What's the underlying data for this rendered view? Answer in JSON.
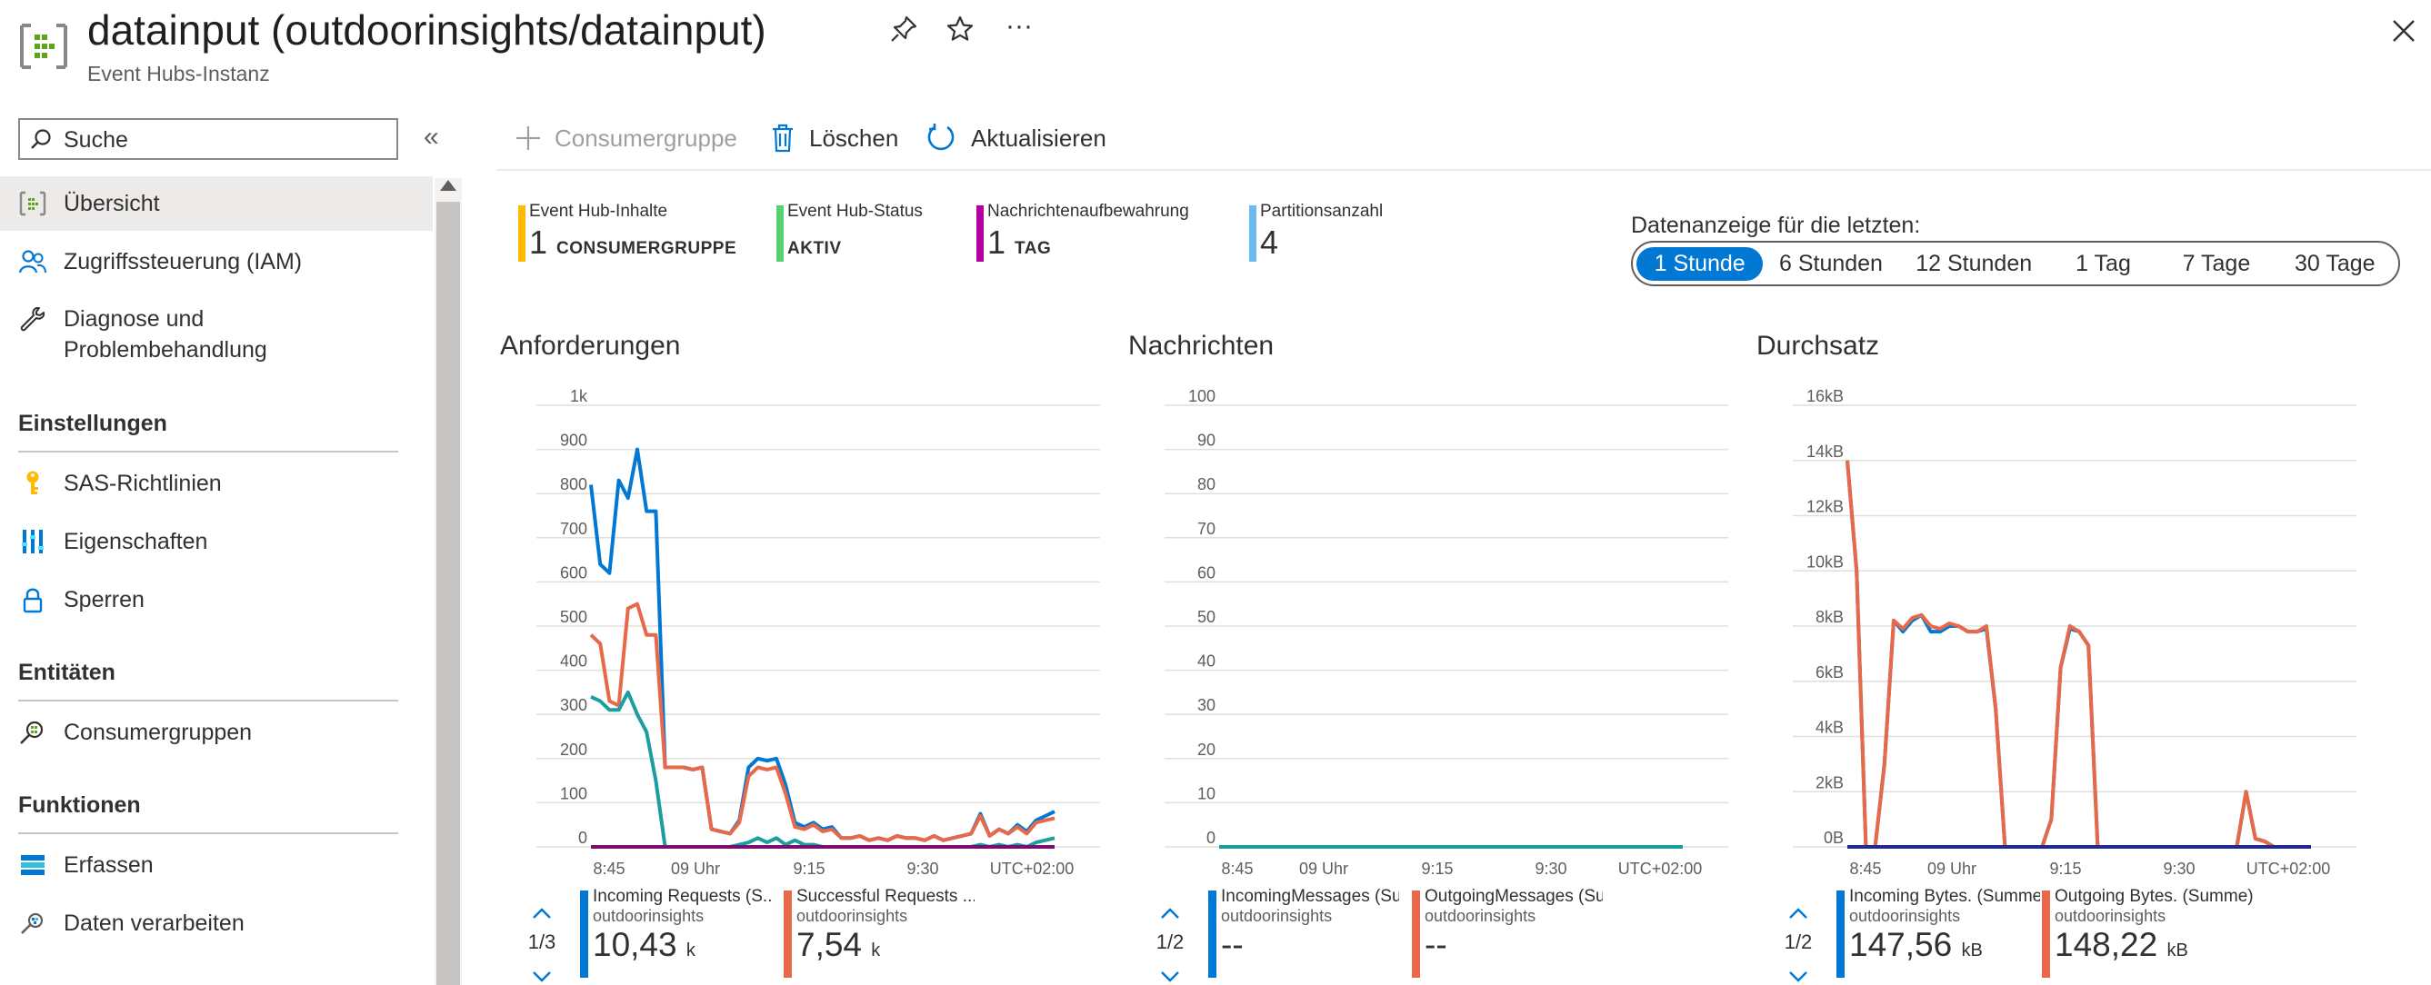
{
  "header": {
    "title": "datainput (outdoorinsights/datainput)",
    "subtitle": "Event Hubs-Instanz",
    "more_label": "···"
  },
  "sidebar": {
    "search_placeholder": "Suche",
    "collapse_label": "«",
    "items": [
      {
        "label": "Übersicht",
        "icon": "event-hub-icon",
        "active": true
      },
      {
        "label": "Zugriffssteuerung (IAM)",
        "icon": "people-icon"
      },
      {
        "label": "Diagnose und\nProblembehandlung",
        "icon": "wrench-icon"
      }
    ],
    "sections": [
      {
        "title": "Einstellungen",
        "items": [
          {
            "label": "SAS-Richtlinien",
            "icon": "key-icon"
          },
          {
            "label": "Eigenschaften",
            "icon": "properties-icon"
          },
          {
            "label": "Sperren",
            "icon": "lock-icon"
          }
        ]
      },
      {
        "title": "Entitäten",
        "items": [
          {
            "label": "Consumergruppen",
            "icon": "consumer-group-icon"
          }
        ]
      },
      {
        "title": "Funktionen",
        "items": [
          {
            "label": "Erfassen",
            "icon": "capture-icon"
          },
          {
            "label": "Daten verarbeiten",
            "icon": "process-data-icon"
          }
        ]
      }
    ]
  },
  "toolbar": {
    "consumer_group": "Consumergruppe",
    "delete": "Löschen",
    "refresh": "Aktualisieren"
  },
  "essentials": [
    {
      "label": "Event Hub-Inhalte",
      "value": "1",
      "unit": "CONSUMERGRUPPE",
      "color": "#ffb900"
    },
    {
      "label": "Event Hub-Status",
      "value": "",
      "unit": "AKTIV",
      "color": "#57d16e"
    },
    {
      "label": "Nachrichtenaufbewahrung",
      "value": "1",
      "unit": "TAG",
      "color": "#b4009e"
    },
    {
      "label": "Partitionsanzahl",
      "value": "4",
      "unit": "",
      "color": "#6ab9f0"
    }
  ],
  "time_range": {
    "label": "Datenanzeige für die letzten:",
    "options": [
      "1 Stunde",
      "6 Stunden",
      "12 Stunden",
      "1 Tag",
      "7 Tage",
      "30 Tage"
    ],
    "selected": "1 Stunde"
  },
  "charts": {
    "requests": {
      "title": "Anforderungen",
      "y_ticks": [
        "1k",
        "900",
        "800",
        "700",
        "600",
        "500",
        "400",
        "300",
        "200",
        "100",
        "0"
      ],
      "x_ticks": [
        "8:45",
        "09 Uhr",
        "9:15",
        "9:30",
        "UTC+02:00"
      ]
    },
    "messages": {
      "title": "Nachrichten",
      "y_ticks": [
        "100",
        "90",
        "80",
        "70",
        "60",
        "50",
        "40",
        "30",
        "20",
        "10",
        "0"
      ],
      "x_ticks": [
        "8:45",
        "09 Uhr",
        "9:15",
        "9:30",
        "UTC+02:00"
      ]
    },
    "throughput": {
      "title": "Durchsatz",
      "y_ticks": [
        "16kB",
        "14kB",
        "12kB",
        "10kB",
        "8kB",
        "6kB",
        "4kB",
        "2kB",
        "0B"
      ],
      "x_ticks": [
        "8:45",
        "09 Uhr",
        "9:15",
        "9:30",
        "UTC+02:00"
      ]
    }
  },
  "legends": {
    "requests": {
      "page": "1/3",
      "items": [
        {
          "name": "Incoming Requests (S...",
          "sub": "outdoorinsights",
          "value": "10,43",
          "unit": "k",
          "color": "#0078d4"
        },
        {
          "name": "Successful Requests ...",
          "sub": "outdoorinsights",
          "value": "7,54",
          "unit": "k",
          "color": "#e8694a"
        }
      ]
    },
    "messages": {
      "page": "1/2",
      "items": [
        {
          "name": "IncomingMessages (Su...",
          "sub": "outdoorinsights",
          "value": "--",
          "unit": "",
          "color": "#0078d4"
        },
        {
          "name": "OutgoingMessages (Su...",
          "sub": "outdoorinsights",
          "value": "--",
          "unit": "",
          "color": "#e8694a"
        }
      ]
    },
    "throughput": {
      "page": "1/2",
      "items": [
        {
          "name": "Incoming Bytes. (Summe)",
          "sub": "outdoorinsights",
          "value": "147,56",
          "unit": "kB",
          "color": "#0078d4"
        },
        {
          "name": "Outgoing Bytes. (Summe)",
          "sub": "outdoorinsights",
          "value": "148,22",
          "unit": "kB",
          "color": "#e8694a"
        }
      ]
    }
  },
  "chart_data": [
    {
      "type": "line",
      "title": "Anforderungen",
      "ylim": [
        0,
        1000
      ],
      "x": [
        0,
        1,
        2,
        3,
        4,
        5,
        6,
        7,
        8,
        9,
        10,
        11,
        12,
        13,
        14,
        15,
        16,
        17,
        18,
        19,
        20,
        21,
        22,
        23,
        24,
        25,
        26,
        27,
        28,
        29,
        30,
        31,
        32,
        33,
        34,
        35,
        36,
        37,
        38,
        39,
        40,
        41,
        42,
        43,
        44,
        45,
        46,
        47,
        48,
        49,
        50
      ],
      "series": [
        {
          "name": "Incoming Requests (S...",
          "color": "#0078d4",
          "values": [
            820,
            640,
            620,
            830,
            790,
            900,
            760,
            760,
            180,
            180,
            180,
            175,
            180,
            40,
            35,
            30,
            60,
            180,
            200,
            195,
            200,
            140,
            55,
            45,
            55,
            40,
            45,
            20,
            20,
            25,
            15,
            20,
            15,
            25,
            20,
            20,
            15,
            25,
            15,
            20,
            25,
            30,
            75,
            25,
            40,
            30,
            50,
            35,
            60,
            70,
            80
          ]
        },
        {
          "name": "Successful Requests ...",
          "color": "#e8694a",
          "values": [
            480,
            460,
            330,
            320,
            540,
            550,
            480,
            480,
            180,
            180,
            180,
            175,
            180,
            40,
            35,
            30,
            55,
            160,
            180,
            175,
            180,
            120,
            45,
            40,
            50,
            35,
            40,
            20,
            20,
            25,
            15,
            20,
            15,
            25,
            20,
            20,
            15,
            25,
            15,
            20,
            25,
            30,
            70,
            25,
            40,
            30,
            45,
            30,
            55,
            60,
            65
          ]
        },
        {
          "name": "",
          "color": "#1a9ea0",
          "values": [
            340,
            330,
            310,
            310,
            350,
            300,
            260,
            150,
            0,
            0,
            0,
            0,
            0,
            0,
            0,
            0,
            5,
            10,
            20,
            10,
            20,
            5,
            15,
            5,
            5,
            0,
            0,
            0,
            0,
            0,
            0,
            0,
            0,
            0,
            0,
            0,
            0,
            0,
            0,
            0,
            0,
            0,
            5,
            0,
            5,
            0,
            5,
            0,
            10,
            15,
            20
          ]
        },
        {
          "name": "",
          "color": "#7a0e6e",
          "values": [
            0,
            0,
            0,
            0,
            0,
            0,
            0,
            0,
            0,
            0,
            0,
            0,
            0,
            0,
            0,
            0,
            0,
            0,
            0,
            0,
            0,
            0,
            0,
            0,
            0,
            0,
            0,
            0,
            0,
            0,
            0,
            0,
            0,
            0,
            0,
            0,
            0,
            0,
            0,
            0,
            0,
            0,
            0,
            0,
            0,
            0,
            0,
            0,
            0,
            0,
            0
          ]
        }
      ]
    },
    {
      "type": "line",
      "title": "Nachrichten",
      "ylim": [
        0,
        100
      ],
      "x": [
        0,
        50
      ],
      "series": [
        {
          "name": "IncomingMessages (Su...",
          "color": "#0078d4",
          "values": [
            0,
            0
          ]
        },
        {
          "name": "OutgoingMessages (Su...",
          "color": "#e8694a",
          "values": [
            0,
            0
          ]
        },
        {
          "name": "",
          "color": "#1a9ea0",
          "values": [
            0,
            0
          ]
        }
      ]
    },
    {
      "type": "line",
      "title": "Durchsatz",
      "ylim": [
        0,
        16
      ],
      "x": [
        0,
        1,
        2,
        3,
        4,
        5,
        6,
        7,
        8,
        9,
        10,
        11,
        12,
        13,
        14,
        15,
        16,
        17,
        18,
        19,
        20,
        21,
        22,
        23,
        24,
        25,
        26,
        27,
        28,
        29,
        30,
        31,
        32,
        33,
        34,
        35,
        36,
        37,
        38,
        39,
        40,
        41,
        42,
        43,
        44,
        45,
        46,
        47,
        48,
        49,
        50
      ],
      "series": [
        {
          "name": "Incoming Bytes. (Summe)",
          "color": "#0078d4",
          "values": [
            14,
            10,
            0,
            0,
            3,
            8.2,
            7.8,
            8.2,
            8.4,
            7.8,
            7.8,
            8.0,
            8.0,
            7.8,
            7.8,
            7.9,
            5,
            0,
            0,
            0,
            0,
            0,
            1,
            6.5,
            7.9,
            7.8,
            7.3,
            0,
            0,
            0,
            0,
            0,
            0,
            0,
            0,
            0,
            0,
            0,
            0,
            0,
            0,
            0,
            0,
            2.0,
            0.3,
            0.2,
            0,
            0,
            0,
            0,
            0
          ]
        },
        {
          "name": "Outgoing Bytes. (Summe)",
          "color": "#e8694a",
          "values": [
            14,
            10,
            0,
            0,
            3,
            8.2,
            7.9,
            8.3,
            8.4,
            8.0,
            7.9,
            8.1,
            8.0,
            7.8,
            7.8,
            8.0,
            5,
            0,
            0,
            0,
            0,
            0,
            1,
            6.5,
            8.0,
            7.8,
            7.3,
            0,
            0,
            0,
            0,
            0,
            0,
            0,
            0,
            0,
            0,
            0,
            0,
            0,
            0,
            0,
            0,
            2.0,
            0.3,
            0.2,
            0,
            0,
            0,
            0,
            0
          ]
        },
        {
          "name": "",
          "color": "#1f2a8c",
          "values": [
            0,
            0,
            0,
            0,
            0,
            0,
            0,
            0,
            0,
            0,
            0,
            0,
            0,
            0,
            0,
            0,
            0,
            0,
            0,
            0,
            0,
            0,
            0,
            0,
            0,
            0,
            0,
            0,
            0,
            0,
            0,
            0,
            0,
            0,
            0,
            0,
            0,
            0,
            0,
            0,
            0,
            0,
            0,
            0,
            0,
            0,
            0,
            0,
            0,
            0,
            0
          ]
        }
      ]
    }
  ]
}
